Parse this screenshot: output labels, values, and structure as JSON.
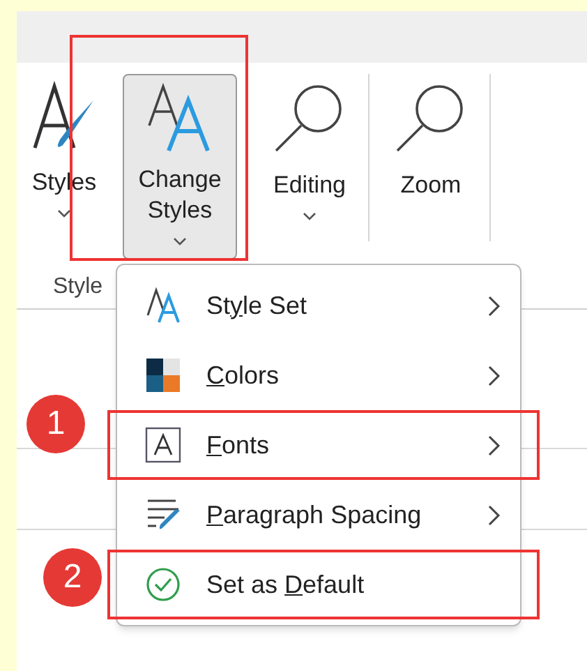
{
  "ribbon": {
    "buttons": [
      {
        "kind": "styles",
        "label": "Styles",
        "dropdown": true,
        "selected": false
      },
      {
        "kind": "change-styles",
        "label": "Change Styles",
        "dropdown": true,
        "selected": true
      },
      {
        "kind": "editing",
        "label": "Editing",
        "dropdown": true,
        "selected": false
      },
      {
        "kind": "zoom",
        "label": "Zoom",
        "dropdown": false,
        "selected": false
      }
    ],
    "group_label": "Style"
  },
  "menu": {
    "items": [
      {
        "kind": "style-set",
        "before": "St",
        "key": "y",
        "after": "le Set",
        "submenu": true,
        "highlighted": false
      },
      {
        "kind": "colors",
        "key": "C",
        "after": "olors",
        "submenu": true,
        "highlighted": false
      },
      {
        "kind": "fonts",
        "key": "F",
        "after": "onts",
        "submenu": true,
        "highlighted": true
      },
      {
        "kind": "paragraph",
        "key": "P",
        "after": "aragraph Spacing",
        "submenu": true,
        "highlighted": false
      },
      {
        "kind": "default",
        "before": "Set as ",
        "key": "D",
        "after": "efault",
        "submenu": false,
        "highlighted": true
      }
    ]
  },
  "step_badges": [
    "1",
    "2"
  ]
}
